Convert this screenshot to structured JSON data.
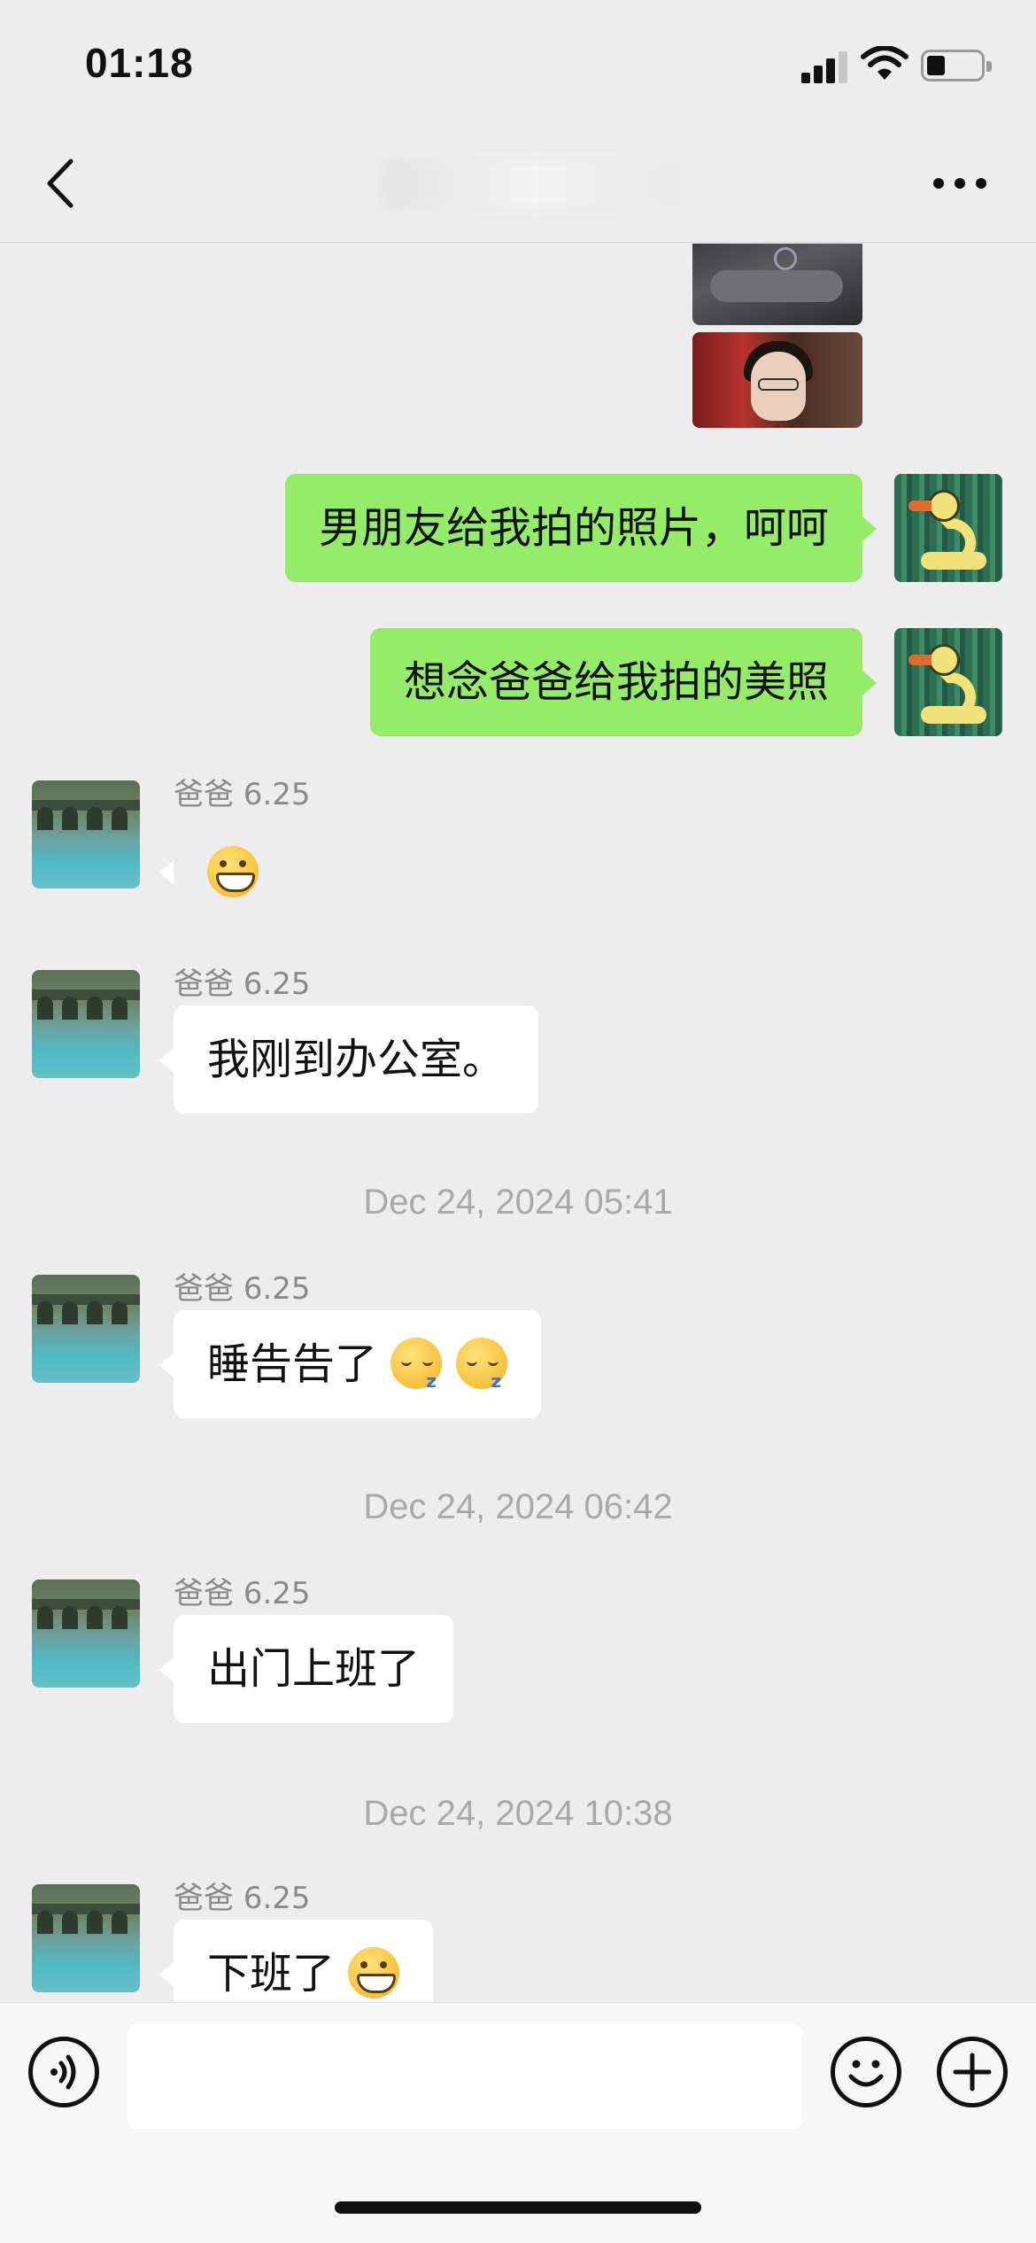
{
  "status_bar": {
    "time": "01:18"
  },
  "messages": [
    {
      "type": "text",
      "direction": "out",
      "text": "男朋友给我拍的照片，呵呵"
    },
    {
      "type": "text",
      "direction": "out",
      "text": "想念爸爸给我拍的美照"
    },
    {
      "type": "text",
      "direction": "in",
      "sender": "爸爸 6.25",
      "text": "",
      "emoji": [
        "grin"
      ]
    },
    {
      "type": "text",
      "direction": "in",
      "sender": "爸爸 6.25",
      "text": "我刚到办公室。"
    },
    {
      "type": "timestamp",
      "text": "Dec 24, 2024 05:41"
    },
    {
      "type": "text",
      "direction": "in",
      "sender": "爸爸 6.25",
      "text": "睡告告了",
      "emoji": [
        "sleeping",
        "sleeping"
      ]
    },
    {
      "type": "timestamp",
      "text": "Dec 24, 2024 06:42"
    },
    {
      "type": "text",
      "direction": "in",
      "sender": "爸爸 6.25",
      "text": "出门上班了"
    },
    {
      "type": "timestamp",
      "text": "Dec 24, 2024 10:38"
    },
    {
      "type": "text",
      "direction": "in",
      "sender": "爸爸 6.25",
      "text": "下班了",
      "emoji": [
        "grin"
      ]
    }
  ],
  "icons": {
    "back": "chevron-left-icon",
    "more": "more-dots-icon",
    "voice": "voice-icon",
    "emoji": "emoji-face-icon",
    "plus": "plus-icon"
  },
  "colors": {
    "outgoing_bubble": "#95ec69",
    "incoming_bubble": "#ffffff",
    "background": "#ededed"
  }
}
